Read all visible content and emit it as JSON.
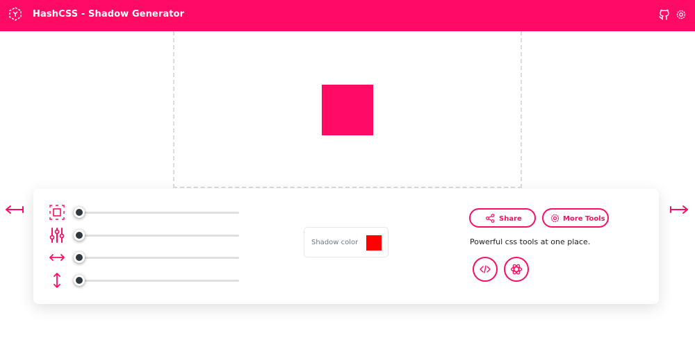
{
  "header": {
    "title": "HashCSS - Shadow Generator",
    "logo_icon": "hex-logo-icon",
    "github_icon": "github-icon",
    "settings_icon": "gear-icon"
  },
  "colors": {
    "accent": "#ff0a64",
    "shadow_color": "#ff0000",
    "preview_box": "#ff0a64"
  },
  "nav": {
    "prev_icon": "arrow-left-icon",
    "next_icon": "arrow-right-icon"
  },
  "controls": {
    "sliders": [
      {
        "icon": "spread-icon",
        "value": 0
      },
      {
        "icon": "blur-sliders-icon",
        "value": 0
      },
      {
        "icon": "horizontal-offset-icon",
        "value": 0
      },
      {
        "icon": "vertical-offset-icon",
        "value": 0
      }
    ],
    "shadow_color_label": "Shadow color"
  },
  "actions": {
    "share_label": "Share",
    "more_tools_label": "More Tools",
    "tagline": "Powerful css tools at one place.",
    "code_icon": "code-icon",
    "brand_icon": "openai-icon"
  }
}
